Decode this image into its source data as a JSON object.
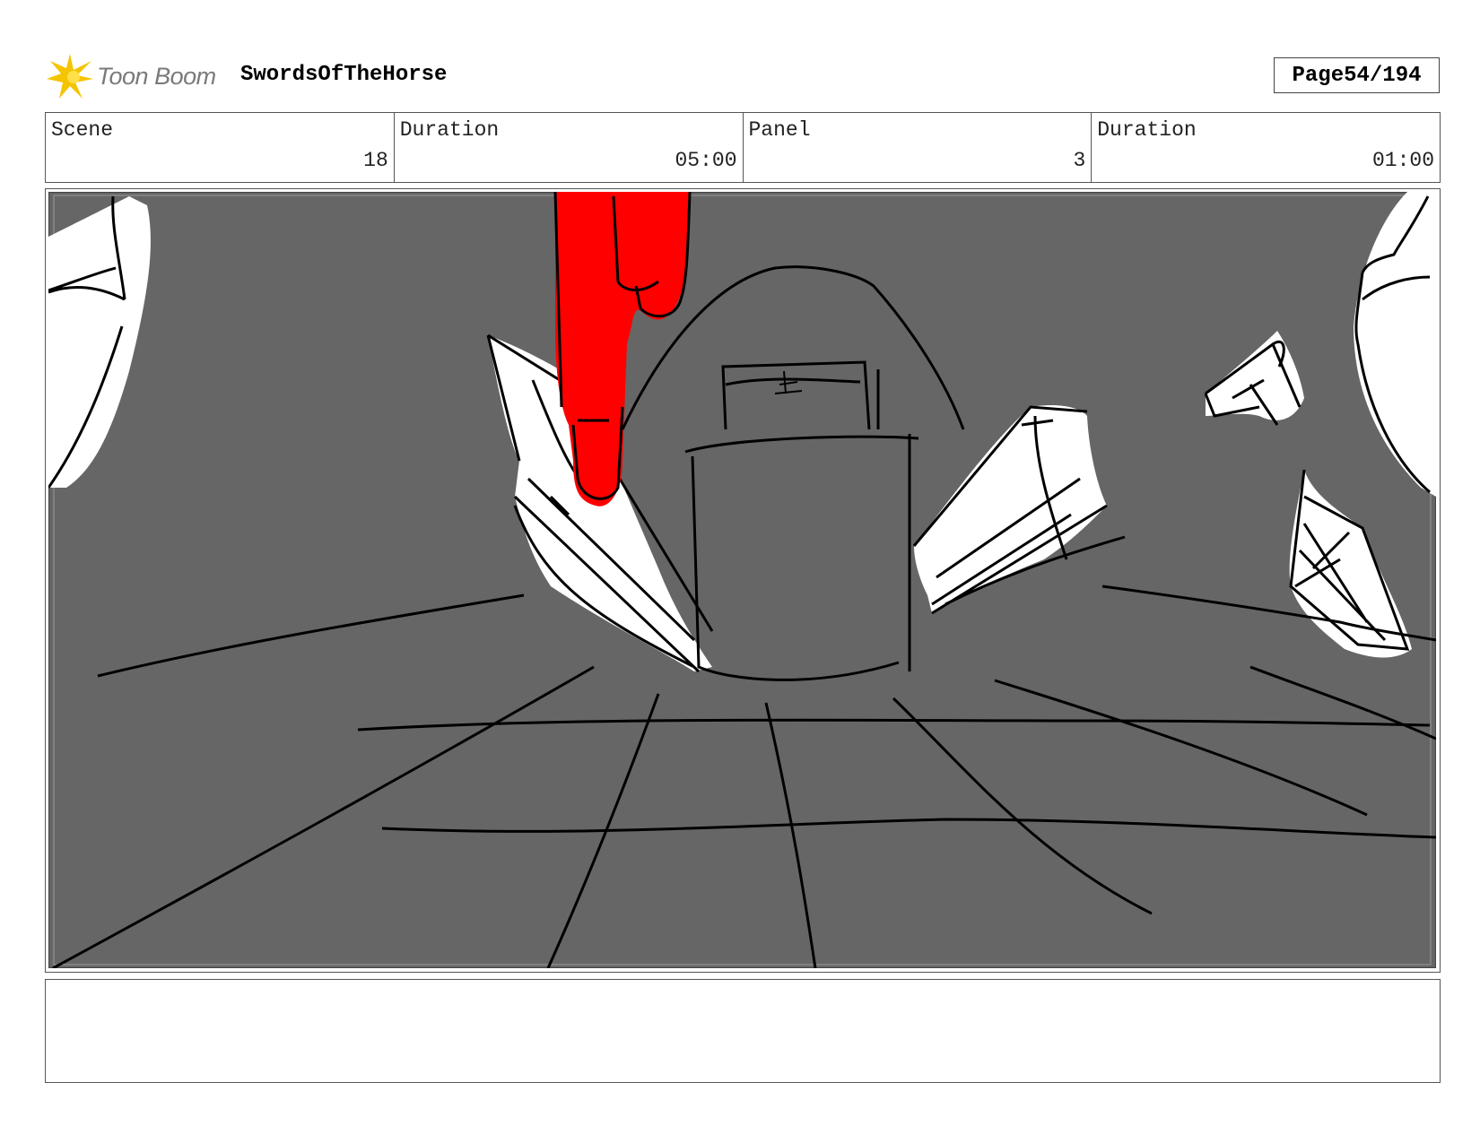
{
  "header": {
    "logo_text": "Toon Boom",
    "project_title": "SwordsOfTheHorse",
    "page_label": "Page",
    "page_value": "54/194"
  },
  "info": {
    "scene_label": "Scene",
    "scene_value": "18",
    "scene_duration_label": "Duration",
    "scene_duration_value": "05:00",
    "panel_label": "Panel",
    "panel_value": "3",
    "panel_duration_label": "Duration",
    "panel_duration_value": "01:00"
  },
  "notes": {
    "text": ""
  },
  "colors": {
    "background_gray": "#666666",
    "accent_red": "#ff0000",
    "logo_yellow": "#f5c400"
  }
}
